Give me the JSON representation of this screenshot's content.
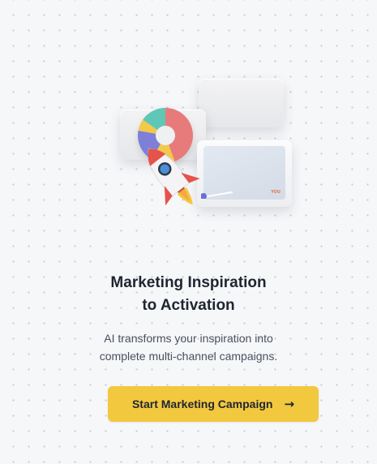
{
  "hero": {
    "title_line1": "Marketing Inspiration",
    "title_line2": "to Activation",
    "description_line1": "AI transforms your inspiration into",
    "description_line2": "complete multi-channel campaigns.",
    "screen_badge": "YOU"
  },
  "cta": {
    "label": "Start Marketing Campaign",
    "icon": "arrow-right-icon"
  },
  "colors": {
    "background": "#f6f7f9",
    "accent": "#f2c83f",
    "text_primary": "#1f2530",
    "text_secondary": "#4a5060"
  },
  "illustration": {
    "icons": [
      "donut-chart-icon",
      "rocket-icon",
      "screen-card-icon"
    ]
  }
}
